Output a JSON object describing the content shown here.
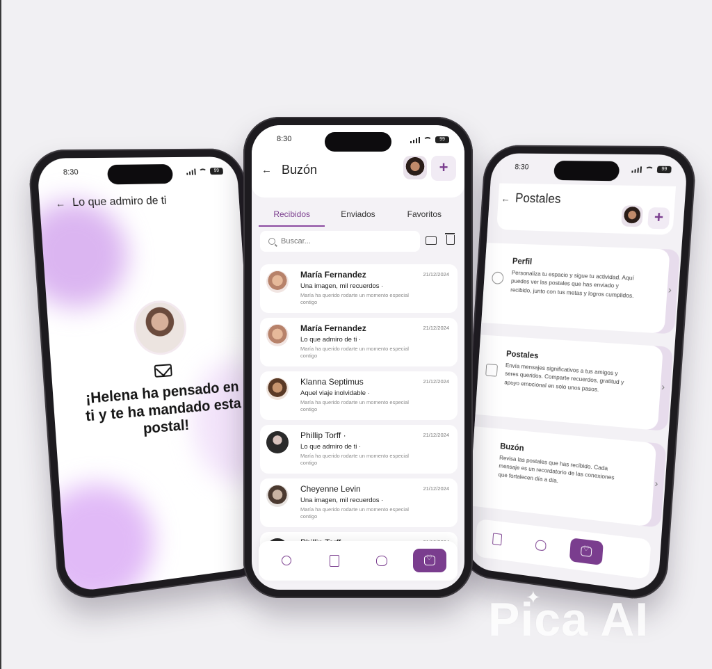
{
  "status": {
    "time": "8:30",
    "battery": "99"
  },
  "left_phone": {
    "title": "Lo que admiro de ti",
    "message": "¡Helena ha pensado en ti y te ha mandado esta postal!"
  },
  "center_phone": {
    "title": "Buzón",
    "tabs": [
      "Recibidos",
      "Enviados",
      "Favoritos"
    ],
    "active_tab": "Recibidos",
    "search_placeholder": "Buscar...",
    "messages": [
      {
        "name": "María Fernandez",
        "date": "21/12/2024",
        "subject": "Una imagen, mil recuerdos ·",
        "preview": "María ha querido rodarte un momento especial contigo"
      },
      {
        "name": "María Fernandez",
        "date": "21/12/2024",
        "subject": "Lo que admiro de ti ·",
        "preview": "María ha querido rodarte un momento especial contigo"
      },
      {
        "name": "Klanna Septimus",
        "date": "21/12/2024",
        "subject": "Aquel viaje inolvidable ·",
        "preview": "María ha querido rodarte un momento especial contigo"
      },
      {
        "name": "Phillip Torff ·",
        "date": "21/12/2024",
        "subject": "Lo que admiro de ti ·",
        "preview": "María ha querido rodarte un momento especial contigo"
      },
      {
        "name": "Cheyenne Levin",
        "date": "21/12/2024",
        "subject": "Una imagen, mil recuerdos ·",
        "preview": "María ha querido rodarte un momento especial contigo"
      },
      {
        "name": "Phillip Torff ·",
        "date": "21/12/2024",
        "subject": "",
        "preview": ""
      }
    ]
  },
  "right_phone": {
    "title": "Postales",
    "cards": [
      {
        "title": "Perfil",
        "body": "Personaliza tu espacio y sigue tu actividad. Aquí puedes ver las postales que has enviado y recibido, junto con tus metas y logros cumplidos."
      },
      {
        "title": "Postales",
        "body": "Envía mensajes significativos a tus amigos y seres queridos. Comparte recuerdos, gratitud y apoyo emocional en solo unos pasos."
      },
      {
        "title": "Buzón",
        "body": "Revisa las postales que has recibido. Cada mensaje es un recordatorio de las conexiones que fortalecen día a día."
      }
    ]
  },
  "watermark": "Pica AI",
  "colors": {
    "accent": "#7a3d8e",
    "background": "#f1f0f3",
    "card_shadow": "#e7dcec"
  }
}
